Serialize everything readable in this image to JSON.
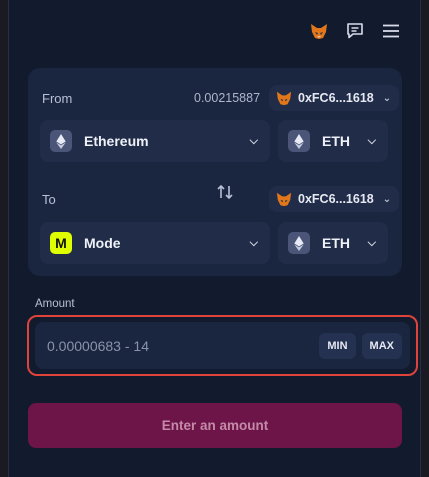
{
  "topbar": {
    "icons": [
      "metamask-fox-icon",
      "chat-icon",
      "menu-icon"
    ]
  },
  "from": {
    "label": "From",
    "balance": "0.00215887",
    "account": "0xFC6...1618",
    "network": "Ethereum",
    "token": "ETH"
  },
  "to": {
    "label": "To",
    "account": "0xFC6...1618",
    "network": "Mode",
    "network_badge": "M",
    "token": "ETH"
  },
  "amount": {
    "label": "Amount",
    "placeholder": "0.00000683 - 14",
    "min_label": "MIN",
    "max_label": "MAX"
  },
  "submit_label": "Enter an amount",
  "colors": {
    "background": "#121a2d",
    "card": "#1a2540",
    "field": "#202c48",
    "highlight": "#e0433a",
    "submit": "#6d1448",
    "mode_badge": "#dffe00"
  }
}
